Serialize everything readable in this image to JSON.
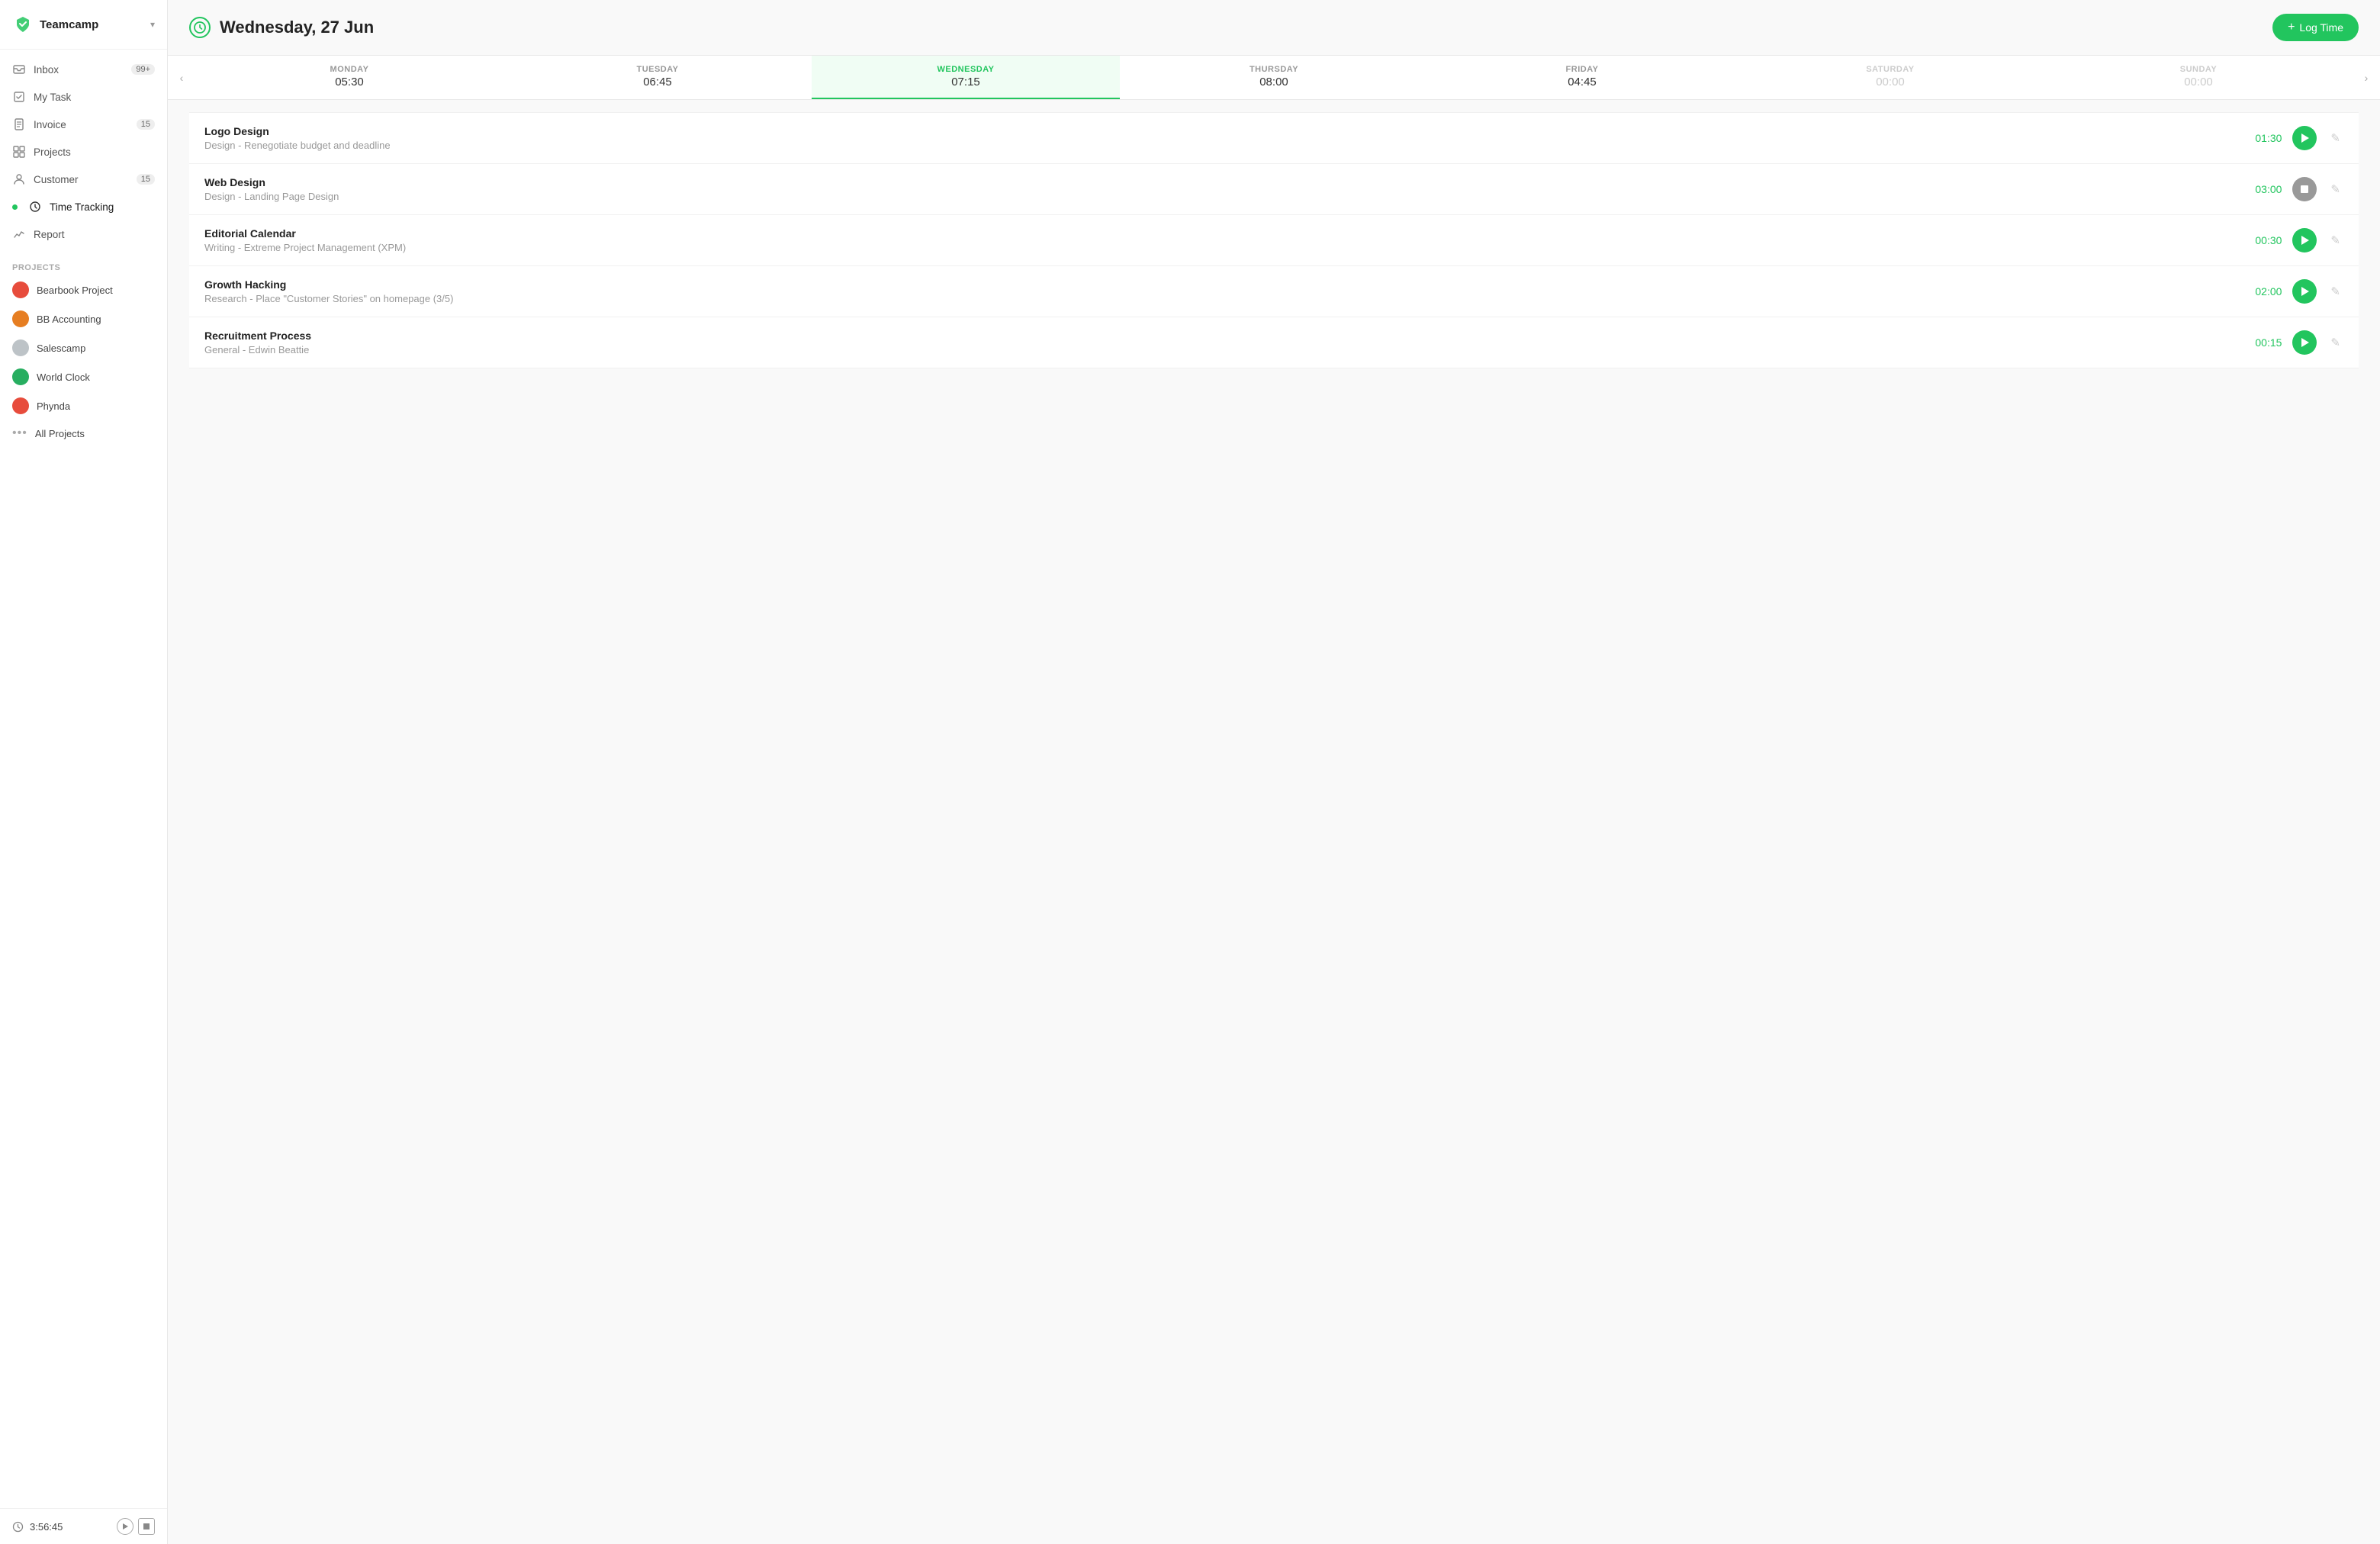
{
  "app": {
    "name": "Teamcamp",
    "chevron": "▾"
  },
  "sidebar": {
    "nav_items": [
      {
        "id": "inbox",
        "label": "Inbox",
        "badge": "99+",
        "icon": "inbox"
      },
      {
        "id": "my-task",
        "label": "My Task",
        "badge": null,
        "icon": "task"
      },
      {
        "id": "invoice",
        "label": "Invoice",
        "badge": "15",
        "icon": "invoice"
      },
      {
        "id": "projects",
        "label": "Projects",
        "badge": null,
        "icon": "projects"
      },
      {
        "id": "customer",
        "label": "Customer",
        "badge": "15",
        "icon": "customer"
      },
      {
        "id": "time-tracking",
        "label": "Time Tracking",
        "badge": null,
        "icon": "clock",
        "active": true
      },
      {
        "id": "report",
        "label": "Report",
        "badge": null,
        "icon": "report"
      }
    ],
    "projects_label": "Projects",
    "projects": [
      {
        "id": "bearbook",
        "label": "Bearbook Project",
        "color": "dot-red"
      },
      {
        "id": "bb-accounting",
        "label": "BB Accounting",
        "color": "dot-orange"
      },
      {
        "id": "salescamp",
        "label": "Salescamp",
        "color": "dot-gray"
      },
      {
        "id": "world-clock",
        "label": "World Clock",
        "color": "dot-green-dark"
      },
      {
        "id": "phynda",
        "label": "Phynda",
        "color": "dot-red2"
      }
    ],
    "all_projects_label": "All Projects",
    "footer": {
      "timer": "3:56:45"
    }
  },
  "header": {
    "title": "Wednesday, 27 Jun",
    "log_time_btn": "+ Log Time"
  },
  "days": [
    {
      "name": "MONDAY",
      "time": "05:30",
      "active": false,
      "dimmed": false
    },
    {
      "name": "TUESDAY",
      "time": "06:45",
      "active": false,
      "dimmed": false
    },
    {
      "name": "WEDNESDAY",
      "time": "07:15",
      "active": true,
      "dimmed": false
    },
    {
      "name": "THURSDAY",
      "time": "08:00",
      "active": false,
      "dimmed": false
    },
    {
      "name": "FRIDAY",
      "time": "04:45",
      "active": false,
      "dimmed": false
    },
    {
      "name": "SATURDAY",
      "time": "00:00",
      "active": false,
      "dimmed": true
    },
    {
      "name": "SUNDAY",
      "time": "00:00",
      "active": false,
      "dimmed": true
    }
  ],
  "entries": [
    {
      "id": "logo-design",
      "title": "Logo Design",
      "subtitle": "Design - Renegotiate budget and deadline",
      "time": "01:30",
      "playing": false,
      "stopped": false
    },
    {
      "id": "web-design",
      "title": "Web Design",
      "subtitle": "Design - Landing Page Design",
      "time": "03:00",
      "playing": false,
      "stopped": true
    },
    {
      "id": "editorial-calendar",
      "title": "Editorial Calendar",
      "subtitle": "Writing - Extreme Project Management (XPM)",
      "time": "00:30",
      "playing": false,
      "stopped": false
    },
    {
      "id": "growth-hacking",
      "title": "Growth Hacking",
      "subtitle": "Research - Place \"Customer Stories\" on homepage (3/5)",
      "time": "02:00",
      "playing": false,
      "stopped": false
    },
    {
      "id": "recruitment-process",
      "title": "Recruitment Process",
      "subtitle": "General - Edwin Beattie",
      "time": "00:15",
      "playing": false,
      "stopped": false
    }
  ]
}
